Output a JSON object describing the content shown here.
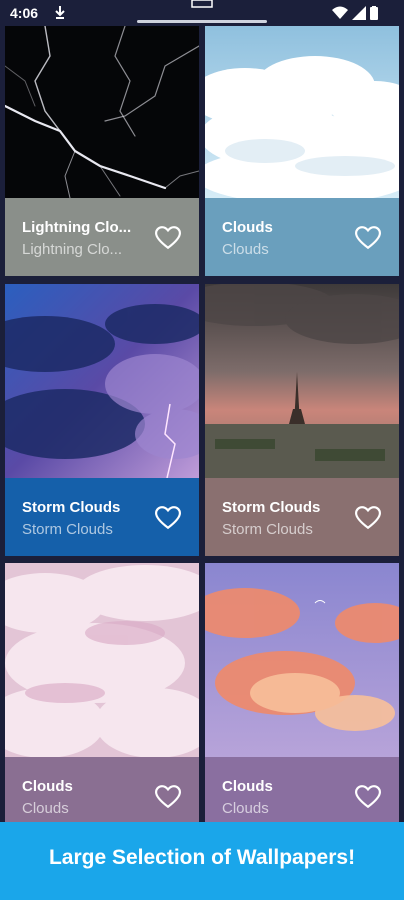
{
  "status_bar": {
    "time": "4:06"
  },
  "cards": [
    {
      "title": "Lightning Clo...",
      "subtitle": "Lightning Clo...",
      "footer_color": "#8a8f8a"
    },
    {
      "title": "Clouds",
      "subtitle": "Clouds",
      "footer_color": "#6a9fbd"
    },
    {
      "title": "Storm Clouds",
      "subtitle": "Storm Clouds",
      "footer_color": "#1560aa"
    },
    {
      "title": "Storm Clouds",
      "subtitle": "Storm Clouds",
      "footer_color": "#8a7070"
    },
    {
      "title": "Clouds",
      "subtitle": "Clouds",
      "footer_color": "#8a6f92"
    },
    {
      "title": "Clouds",
      "subtitle": "Clouds",
      "footer_color": "#8a6fa0"
    }
  ],
  "banner": {
    "text": "Large Selection of Wallpapers!",
    "color": "#1aa6ea"
  }
}
